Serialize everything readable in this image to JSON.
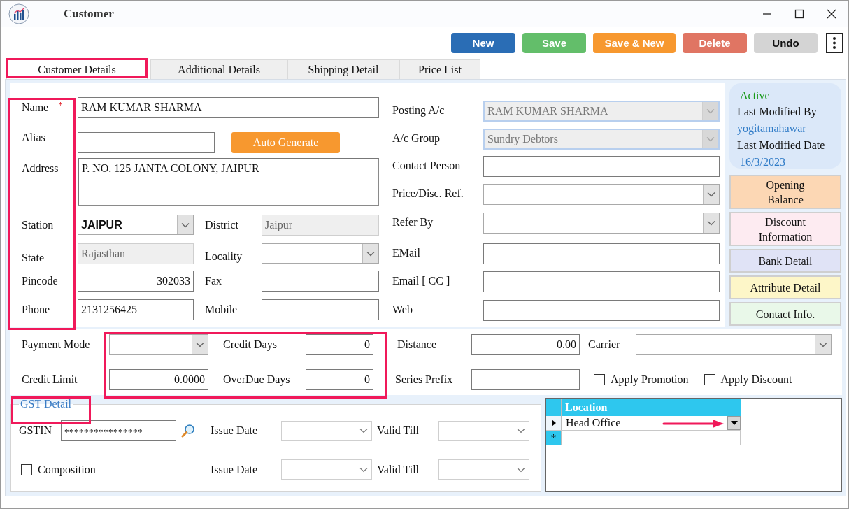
{
  "window": {
    "title": "Customer"
  },
  "toolbar": [
    {
      "label": "New",
      "color": "#2a6db5"
    },
    {
      "label": "Save",
      "color": "#63be6a"
    },
    {
      "label": "Save & New",
      "color": "#f7982f"
    },
    {
      "label": "Delete",
      "color": "#e07563"
    },
    {
      "label": "Undo",
      "color": "#d4d4d4"
    }
  ],
  "tabs": [
    {
      "label": "Customer Details",
      "selected": true
    },
    {
      "label": "Additional Details",
      "selected": false
    },
    {
      "label": "Shipping Detail",
      "selected": false
    },
    {
      "label": "Price List",
      "selected": false
    }
  ],
  "details": {
    "name": {
      "label": "Name",
      "required_mark": "*",
      "value": "RAM KUMAR SHARMA"
    },
    "alias": {
      "label": "Alias"
    },
    "auto_generate_button": "Auto Generate",
    "address": {
      "label": "Address",
      "value": "P. NO. 125 JANTA COLONY, JAIPUR"
    },
    "station": {
      "label": "Station",
      "value": "JAIPUR"
    },
    "district": {
      "label": "District",
      "value": "Jaipur",
      "disabled": true
    },
    "state": {
      "label": "State",
      "value": "Rajasthan",
      "disabled": true
    },
    "locality": {
      "label": "Locality"
    },
    "pincode": {
      "label": "Pincode",
      "value": "302033"
    },
    "fax": {
      "label": "Fax"
    },
    "phone": {
      "label": "Phone",
      "value": "2131256425"
    },
    "mobile": {
      "label": "Mobile"
    }
  },
  "account": [
    {
      "label": "Posting A/c",
      "kind": "combo",
      "value": "RAM KUMAR SHARMA",
      "disabled": true
    },
    {
      "label": "A/c Group",
      "kind": "combo",
      "value": "Sundry Debtors",
      "disabled": true
    },
    {
      "label": "Contact Person",
      "kind": "text",
      "disabled": false
    },
    {
      "label": "Price/Disc. Ref.",
      "kind": "combo",
      "disabled": false
    },
    {
      "label": "Refer By",
      "kind": "combo",
      "disabled": false
    },
    {
      "label": "EMail",
      "kind": "text",
      "disabled": false
    },
    {
      "label": "Email [ CC ]",
      "kind": "text",
      "disabled": false
    },
    {
      "label": "Web",
      "kind": "text",
      "disabled": false
    }
  ],
  "status": {
    "state": "Active",
    "modified_by_label": "Last Modified By",
    "modified_by": "yogitamahawar",
    "modified_date_label": "Last Modified Date",
    "modified_date": "16/3/2023"
  },
  "side_buttons": [
    {
      "label": "Opening Balance",
      "color": "#fcd7b4"
    },
    {
      "label": "Discount Information",
      "color": "#fdebf1"
    },
    {
      "label": "Bank Detail",
      "color": "#e0e3f6"
    },
    {
      "label": "Attribute Detail",
      "color": "#fdf6c8"
    },
    {
      "label": "Contact Info.",
      "color": "#e9f8e9"
    }
  ],
  "terms": {
    "payment_mode": {
      "label": "Payment Mode"
    },
    "credit_days": {
      "label": "Credit Days",
      "value": "0"
    },
    "credit_limit": {
      "label": "Credit Limit",
      "value": "0.0000"
    },
    "overdue_days": {
      "label": "OverDue Days",
      "value": "0"
    },
    "distance": {
      "label": "Distance",
      "value": "0.00"
    },
    "carrier": {
      "label": "Carrier"
    },
    "series_prefix": {
      "label": "Series Prefix"
    },
    "apply_promotion": {
      "label": "Apply Promotion",
      "checked": false
    },
    "apply_discount": {
      "label": "Apply Discount",
      "checked": false
    }
  },
  "gst": {
    "title": "GST Detail",
    "gstin": {
      "label": "GSTIN",
      "value": "****************"
    },
    "date_rows": [
      {
        "issue_label": "Issue Date",
        "valid_label": "Valid Till"
      },
      {
        "issue_label": "Issue Date",
        "valid_label": "Valid Till"
      }
    ],
    "composition": {
      "label": "Composition",
      "checked": false
    }
  },
  "location_grid": {
    "column": "Location",
    "rows": [
      {
        "location": "Head Office",
        "current": true
      }
    ],
    "new_row_mark": "*"
  }
}
